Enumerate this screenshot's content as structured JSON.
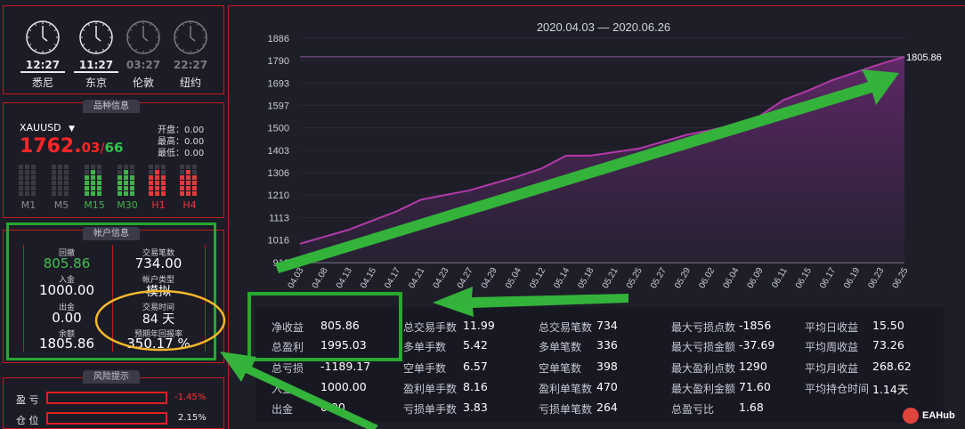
{
  "clocks": [
    {
      "time": "12:27",
      "city": "悉尼",
      "active": true
    },
    {
      "time": "11:27",
      "city": "东京",
      "active": true
    },
    {
      "time": "03:27",
      "city": "伦敦",
      "active": false
    },
    {
      "time": "22:27",
      "city": "纽约",
      "active": false
    }
  ],
  "symbol_section": {
    "tab": "品种信息",
    "symbol": "XAUUSD",
    "price_main": "1762.",
    "price_frac": "03",
    "price_sep": "/",
    "price_ask": "66",
    "open_label": "开盘：0.00",
    "high_label": "最高：0.00",
    "low_label": "最低：0.00",
    "timeframes": [
      "M1",
      "M5",
      "M15",
      "M30",
      "H1",
      "H4"
    ],
    "timeframe_colors": [
      "#6f6f78",
      "#6f6f78",
      "#3fb34a",
      "#3fb34a",
      "#e23b3b",
      "#e23b3b"
    ]
  },
  "account": {
    "tab": "帐户信息",
    "drawdown_label": "回撤",
    "drawdown": "805.86",
    "trades_label": "交易笔数",
    "trades": "734.00",
    "deposit_label": "入金",
    "deposit": "1000.00",
    "account_type_label": "帐户类型",
    "account_type": "模拟",
    "withdraw_label": "出金",
    "withdraw": "0.00",
    "trade_time_label": "交易时间",
    "trade_time": "84 天",
    "balance_label": "余额",
    "balance": "1805.86",
    "annual_label": "预期年回报率",
    "annual": "350.17 %"
  },
  "risk": {
    "tab": "风险提示",
    "profit_label": "盈 亏",
    "profit_value": "-1.45%",
    "position_label": "仓 位",
    "position_value": "2.15%"
  },
  "chart_data": {
    "type": "area",
    "title": "2020.04.03 — 2020.06.26",
    "x": [
      "04.03",
      "04.08",
      "04.13",
      "04.15",
      "04.17",
      "04.21",
      "04.23",
      "04.27",
      "04.29",
      "05.04",
      "05.12",
      "05.14",
      "05.18",
      "05.21",
      "05.25",
      "05.27",
      "05.29",
      "06.02",
      "06.04",
      "06.09",
      "06.11",
      "06.15",
      "06.17",
      "06.19",
      "06.23",
      "06.25"
    ],
    "series": [
      {
        "values": [
          1000,
          1030,
          1060,
          1100,
          1140,
          1190,
          1210,
          1230,
          1260,
          1290,
          1325,
          1380,
          1380,
          1395,
          1410,
          1440,
          1470,
          1490,
          1515,
          1550,
          1620,
          1660,
          1705,
          1740,
          1775,
          1805.86
        ]
      }
    ],
    "y_ticks": [
      "1886",
      "1790",
      "1693",
      "1597",
      "1500",
      "1403",
      "1306",
      "1210",
      "1113",
      "1016",
      "919"
    ],
    "ylim": [
      919,
      1886
    ],
    "last_value_label": "1805.86",
    "line_color": "#b23aa8"
  },
  "stats": {
    "col1": [
      {
        "label": "净收益",
        "value": "805.86"
      },
      {
        "label": "总盈利",
        "value": "1995.03"
      },
      {
        "label": "总亏损",
        "value": "-1189.17"
      },
      {
        "label": "入金",
        "value": "1000.00"
      },
      {
        "label": "出金",
        "value": "0.00"
      }
    ],
    "col2": [
      {
        "label": "总交易手数",
        "value": "11.99"
      },
      {
        "label": "多单手数",
        "value": "5.42"
      },
      {
        "label": "空单手数",
        "value": "6.57"
      },
      {
        "label": "盈利单手数",
        "value": "8.16"
      },
      {
        "label": "亏损单手数",
        "value": "3.83"
      }
    ],
    "col3": [
      {
        "label": "总交易笔数",
        "value": "734"
      },
      {
        "label": "多单笔数",
        "value": "336"
      },
      {
        "label": "空单笔数",
        "value": "398"
      },
      {
        "label": "盈利单笔数",
        "value": "470"
      },
      {
        "label": "亏损单笔数",
        "value": "264"
      }
    ],
    "col4": [
      {
        "label": "最大亏损点数",
        "value": "-1856"
      },
      {
        "label": "最大亏损金额",
        "value": "-37.69"
      },
      {
        "label": "最大盈利点数",
        "value": "1290"
      },
      {
        "label": "最大盈利金额",
        "value": "71.60"
      },
      {
        "label": "总盈亏比",
        "value": "1.68"
      }
    ],
    "col5": [
      {
        "label": "平均日收益",
        "value": "15.50"
      },
      {
        "label": "平均周收益",
        "value": "73.26"
      },
      {
        "label": "平均月收益",
        "value": "268.62"
      },
      {
        "label": "平均持仓时间",
        "value": "1.14天"
      }
    ]
  },
  "watermark": "EAHub"
}
